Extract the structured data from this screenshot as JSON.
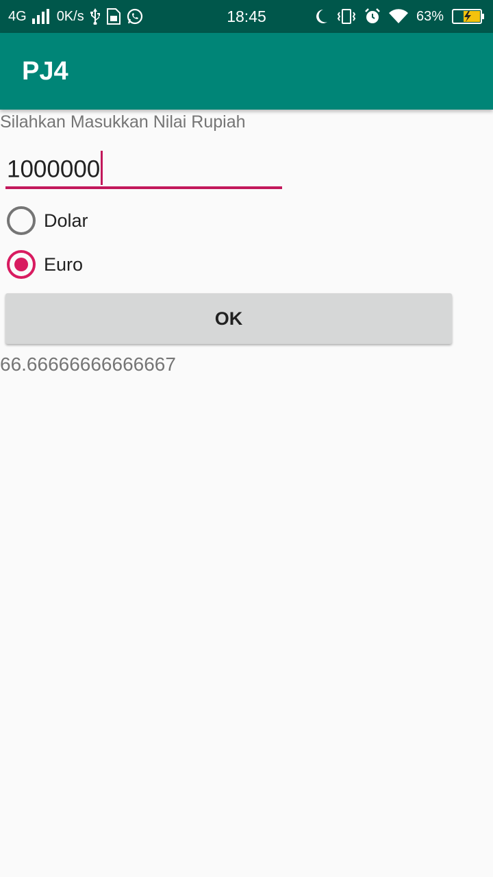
{
  "status_bar": {
    "network": "4G",
    "speed": "0K/s",
    "time": "18:45",
    "battery": "63%",
    "icons": [
      "signal-icon",
      "usb-icon",
      "sim-app-icon",
      "whatsapp-icon",
      "moon-icon",
      "vibrate-icon",
      "alarm-icon",
      "wifi-icon",
      "battery-charging-icon"
    ]
  },
  "app_bar": {
    "title": "PJ4",
    "color": "#008577"
  },
  "form": {
    "prompt": "Silahkan Masukkan Nilai Rupiah",
    "input_value": "1000000",
    "accent_color": "#D81B60",
    "options": [
      {
        "label": "Dolar",
        "checked": false
      },
      {
        "label": "Euro",
        "checked": true
      }
    ],
    "ok_label": "OK",
    "result": "66.66666666666667"
  }
}
